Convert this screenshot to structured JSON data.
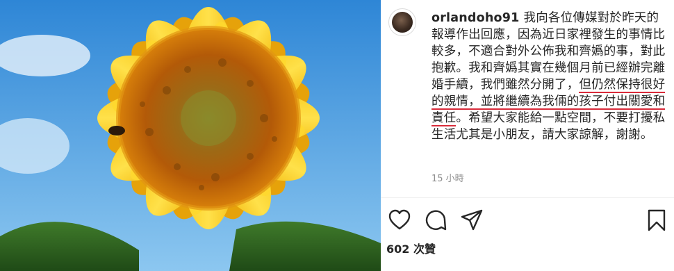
{
  "post": {
    "username": "orlandoho91",
    "caption_before": "我向各位傳媒對於昨天的報導作出回應，因為近日家裡發生的事情比較多，不適合對外公佈我和齊嬀的事，對此抱歉。我和齊嬀其實在幾個月前已經辦完離婚手續，我們雖然分開了，",
    "caption_highlight_1": "但仍然保持很好的親情，並將繼續為我倆的孩子付出關愛和責任",
    "caption_after": "。希望大家能給一點空間，不要打擾私生活尤其是小朋友，請大家諒解，謝謝。",
    "time_ago": "15 小時",
    "likes": "602 次贊"
  },
  "icons": {
    "like": "heart-icon",
    "comment": "comment-icon",
    "share": "send-icon",
    "save": "bookmark-icon"
  },
  "colors": {
    "underline": "#d92b3a",
    "text": "#262626",
    "muted": "#8e8e8e"
  }
}
